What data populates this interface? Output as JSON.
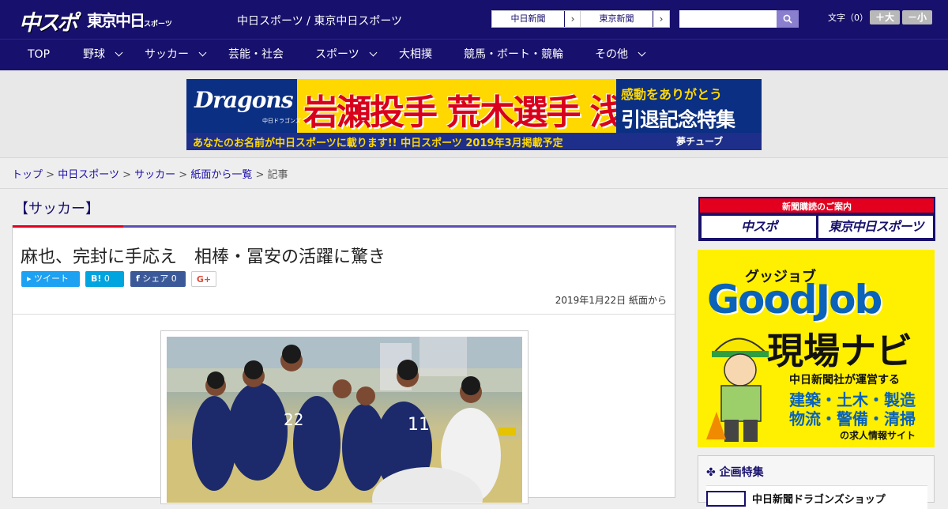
{
  "header": {
    "logo_main": "中スポ",
    "logo_tokyo": "東京中日",
    "logo_tokyo_sub": "スポーツ",
    "site_names": "中日スポーツ / 東京中日スポーツ",
    "paper_links": [
      "中日新聞",
      "東京新聞"
    ],
    "search_placeholder": "",
    "font_size_label": "文字（0）",
    "font_larger": "＋大",
    "font_smaller": "－小"
  },
  "nav": {
    "items": [
      {
        "label": "TOP",
        "has_dropdown": false
      },
      {
        "label": "野球",
        "has_dropdown": true
      },
      {
        "label": "サッカー",
        "has_dropdown": true
      },
      {
        "label": "芸能・社会",
        "has_dropdown": false
      },
      {
        "label": "スポーツ",
        "has_dropdown": true
      },
      {
        "label": "大相撲",
        "has_dropdown": false
      },
      {
        "label": "競馬・ボート・競輪",
        "has_dropdown": false
      },
      {
        "label": "その他",
        "has_dropdown": true
      }
    ]
  },
  "banner": {
    "team": "Dragons",
    "team_sub": "中日ドラゴンズ",
    "names": "岩瀬投手 荒木選手 浅尾投手",
    "thanks": "感動をありがとう",
    "special": "引退記念特集",
    "bottom_text": "あなたのお名前が中日スポーツに載ります!! 中日スポーツ 2019年3月掲載予定",
    "bottom_brand": "夢チューブ"
  },
  "breadcrumb": {
    "links": [
      "トップ",
      "中日スポーツ",
      "サッカー",
      "紙面から一覧"
    ],
    "current": "記事",
    "separator": ">"
  },
  "article": {
    "category": "【サッカー】",
    "headline": "麻也、完封に手応え　相棒・冨安の活躍に驚き",
    "share": {
      "tweet": "ツイート",
      "hatena": "B!",
      "hatena_count": "0",
      "facebook": "シェア",
      "facebook_count": "0",
      "gplus": "G+"
    },
    "pubdate": "2019年1月22日 紙面から"
  },
  "sidebar": {
    "subscribe_title": "新聞購読のご案内",
    "subscribe_items": [
      "中スポ",
      "東京中日スポーツ"
    ],
    "goodjob": {
      "katakana": "グッジョブ",
      "title": "GoodJob",
      "subtitle": "現場ナビ",
      "operator": "中日新聞社が運営する",
      "jobs_line1": "建築・土木・製造",
      "jobs_line2": "物流・警備・清掃",
      "tagline": "の求人情報サイト"
    },
    "kikaku_title": "企画特集",
    "kikaku_item": "中日新聞ドラゴンズショップ"
  },
  "colors": {
    "brand_navy": "#17106c",
    "accent_red": "#e3001f",
    "twitter": "#1da1f2",
    "hatena": "#00a4de",
    "facebook": "#3b5998"
  }
}
